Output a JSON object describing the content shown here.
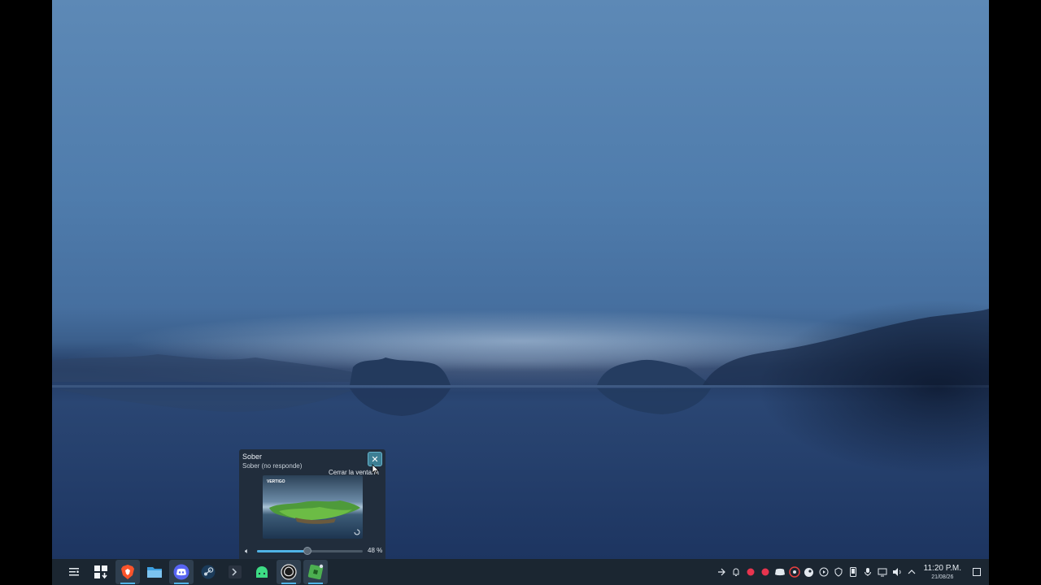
{
  "window_preview": {
    "title": "Sober",
    "subtitle": "Sober (no responde)",
    "close_tooltip": "Cerrar la ventana",
    "thumbnail_label": "VERTIGO",
    "volume": 0.48,
    "volume_label": "48 %"
  },
  "taskbar": {
    "items": [
      {
        "icon": "app-menu-icon"
      },
      {
        "icon": "grid-overview-icon"
      },
      {
        "icon": "brave-browser-icon"
      },
      {
        "icon": "file-manager-icon"
      },
      {
        "icon": "discord-icon"
      },
      {
        "icon": "steam-icon"
      },
      {
        "icon": "terminal-icon"
      },
      {
        "icon": "android-icon"
      },
      {
        "icon": "obs-icon"
      },
      {
        "icon": "sober-roblox-icon"
      }
    ],
    "tray": [
      "network-icon",
      "notification-bell-icon",
      "record-dot-icon",
      "record-dot-icon",
      "discord-tray-icon",
      "obs-tray-icon",
      "steam-tray-icon",
      "media-play-icon",
      "shield-icon",
      "phone-icon",
      "microphone-icon",
      "display-icon",
      "volume-icon",
      "expand-arrow-icon"
    ],
    "clock": {
      "time": "11:20 P.M.",
      "date": "21/08/26"
    }
  },
  "colors": {
    "accent": "#4fb3e6",
    "taskbar": "#1b2631"
  }
}
